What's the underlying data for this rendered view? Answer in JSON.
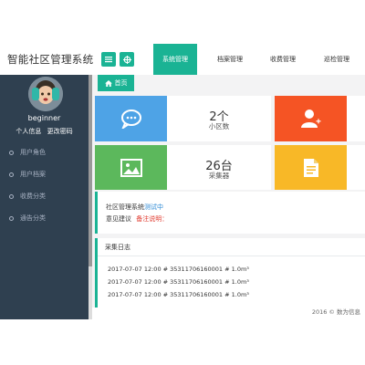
{
  "header": {
    "brand": "智能社区管理系统",
    "menu_icon": "list-icon",
    "home_icon": "crosshair-icon",
    "tabs": [
      {
        "label": "系统管理"
      },
      {
        "label": "档案管理"
      },
      {
        "label": "收费管理"
      },
      {
        "label": "巡检管理"
      }
    ]
  },
  "sidebar": {
    "username": "beginner",
    "links": [
      "个人信息",
      "更改密码"
    ],
    "items": [
      {
        "label": "用户角色"
      },
      {
        "label": "用户档案"
      },
      {
        "label": "收费分类"
      },
      {
        "label": "通告分类"
      }
    ]
  },
  "page_tab": {
    "label": "首页",
    "icon": "home-icon"
  },
  "stats": [
    {
      "value": "2个",
      "label": "小区数",
      "icon": "chat-icon",
      "color": "#4ea3e6"
    },
    {
      "value": "",
      "label": "",
      "icon": "add-user-icon",
      "color": "#f55424"
    },
    {
      "value": "26台",
      "label": "采集器",
      "icon": "image-icon",
      "color": "#5cb85c"
    },
    {
      "value": "",
      "label": "",
      "icon": "document-icon",
      "color": "#f8b827"
    }
  ],
  "notice": {
    "line1_prefix": "社区管理系统",
    "line1_highlight": "测试中",
    "line2_prefix": "意见建议",
    "line2_highlight": "备注说明：",
    "highlight_blue": "#2e8bd6",
    "highlight_red": "#e0382c"
  },
  "log": {
    "title": "采集日志",
    "lines": [
      "2017-07-07 12:00 # 35311706160001 # 1.0m³",
      "2017-07-07 12:00 # 35311706160001 # 1.0m³",
      "2017-07-07 12:00 # 35311706160001 # 1.0m³"
    ]
  },
  "footer": {
    "text": "2016 ©   数为信息"
  }
}
